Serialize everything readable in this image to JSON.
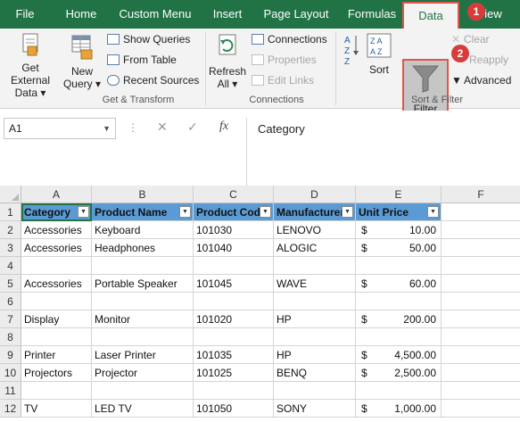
{
  "tabs": [
    {
      "label": "File",
      "active": false
    },
    {
      "label": "Home",
      "active": false
    },
    {
      "label": "Custom Menu",
      "active": false
    },
    {
      "label": "Insert",
      "active": false
    },
    {
      "label": "Page Layout",
      "active": false
    },
    {
      "label": "Formulas",
      "active": false
    },
    {
      "label": "Data",
      "active": true
    },
    {
      "label": "iew",
      "active": false
    }
  ],
  "badges": [
    "1",
    "2"
  ],
  "ribbon": {
    "get_external": [
      "Get External",
      "Data ▾"
    ],
    "new_query": [
      "New",
      "Query ▾"
    ],
    "show_queries": "Show Queries",
    "from_table": "From Table",
    "recent_sources": "Recent Sources",
    "get_transform": "Get & Transform",
    "refresh_all": [
      "Refresh",
      "All ▾"
    ],
    "connections": "Connections",
    "properties": "Properties",
    "edit_links": "Edit Links",
    "connections_group": "Connections",
    "sort": "Sort",
    "filter": "Filter",
    "clear": "Clear",
    "reapply": "Reapply",
    "advanced": "Advanced",
    "sort_filter": "Sort & Filter"
  },
  "formula_bar": {
    "name_box": "A1",
    "fx": "fx",
    "content": "Category"
  },
  "columns": [
    "A",
    "B",
    "C",
    "D",
    "E",
    "F"
  ],
  "rows": [
    "1",
    "2",
    "3",
    "4",
    "5",
    "6",
    "7",
    "8",
    "9",
    "10",
    "11",
    "12"
  ],
  "headers": [
    "Category",
    "Product Name",
    "Product Code",
    "Manufacturer",
    "Unit Price"
  ],
  "data": [
    {
      "cat": "Accessories",
      "name": "Keyboard",
      "code": "101030",
      "mfr": "LENOVO",
      "cur": "$",
      "price": "10.00"
    },
    {
      "cat": "Accessories",
      "name": "Headphones",
      "code": "101040",
      "mfr": "ALOGIC",
      "cur": "$",
      "price": "50.00"
    },
    {
      "cat": "",
      "name": "",
      "code": "",
      "mfr": "",
      "cur": "",
      "price": ""
    },
    {
      "cat": "Accessories",
      "name": "Portable Speaker",
      "code": "101045",
      "mfr": "WAVE",
      "cur": "$",
      "price": "60.00"
    },
    {
      "cat": "",
      "name": "",
      "code": "",
      "mfr": "",
      "cur": "",
      "price": ""
    },
    {
      "cat": "Display",
      "name": "Monitor",
      "code": "101020",
      "mfr": "HP",
      "cur": "$",
      "price": "200.00"
    },
    {
      "cat": "",
      "name": "",
      "code": "",
      "mfr": "",
      "cur": "",
      "price": ""
    },
    {
      "cat": "Printer",
      "name": "Laser Printer",
      "code": "101035",
      "mfr": "HP",
      "cur": "$",
      "price": "4,500.00"
    },
    {
      "cat": "Projectors",
      "name": "Projector",
      "code": "101025",
      "mfr": "BENQ",
      "cur": "$",
      "price": "2,500.00"
    },
    {
      "cat": "",
      "name": "",
      "code": "",
      "mfr": "",
      "cur": "",
      "price": ""
    },
    {
      "cat": "TV",
      "name": "LED TV",
      "code": "101050",
      "mfr": "SONY",
      "cur": "$",
      "price": "1,000.00"
    }
  ],
  "colors": {
    "brand": "#217346",
    "header_fill": "#5b9bd5",
    "highlight": "#e0564a"
  }
}
